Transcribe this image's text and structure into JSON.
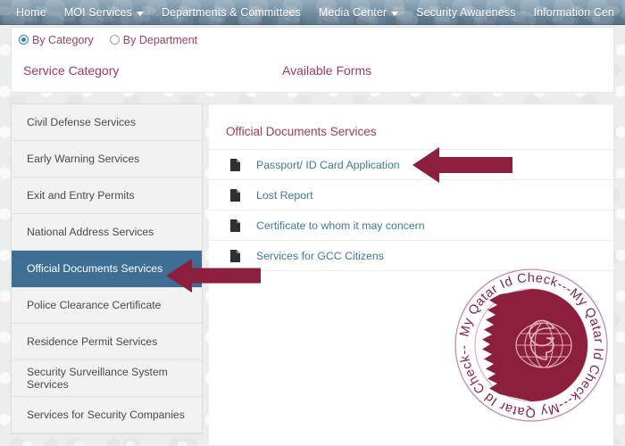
{
  "colors": {
    "navbar_bg": "#6e8ca3",
    "accent_maroon": "#a23a52",
    "link_blue": "#3b7a99",
    "selected_row_bg": "#3f6e94",
    "arrow_maroon": "#8c1f3d",
    "seal_maroon": "#8c1f3d",
    "radio_blue": "#2b7fd4"
  },
  "navbar": {
    "items": [
      {
        "label": "Home",
        "has_caret": false
      },
      {
        "label": "MOI Services",
        "has_caret": true
      },
      {
        "label": "Departments & Committees",
        "has_caret": false
      },
      {
        "label": "Media Center",
        "has_caret": true
      },
      {
        "label": "Security Awareness",
        "has_caret": false
      },
      {
        "label": "Information Cen",
        "has_caret": false
      }
    ]
  },
  "filter": {
    "options": [
      {
        "label": "By Category",
        "selected": true
      },
      {
        "label": "By Department",
        "selected": false
      }
    ]
  },
  "headers": {
    "service_category": "Service Category",
    "available_forms": "Available Forms"
  },
  "sidebar": {
    "items": [
      {
        "label": "Civil Defense Services",
        "active": false
      },
      {
        "label": "Early Warning Services",
        "active": false
      },
      {
        "label": "Exit and Entry Permits",
        "active": false
      },
      {
        "label": "National Address Services",
        "active": false
      },
      {
        "label": "Official Documents Services",
        "active": true
      },
      {
        "label": "Police Clearance Certificate",
        "active": false
      },
      {
        "label": "Residence Permit Services",
        "active": false
      },
      {
        "label": "Security Surveillance System Services",
        "active": false
      },
      {
        "label": "Services for Security Companies",
        "active": false
      }
    ]
  },
  "content": {
    "title": "Official Documents Services",
    "forms": [
      {
        "label": "Passport/ ID Card Application",
        "icon": "document-icon"
      },
      {
        "label": "Lost Report",
        "icon": "document-icon"
      },
      {
        "label": "Certificate to whom it may concern",
        "icon": "document-icon"
      },
      {
        "label": "Services for GCC Citizens",
        "icon": "document-icon"
      }
    ]
  },
  "seal": {
    "ring_text": "My Qatar Id Check---My Qatar Id Check---My Qatar Id Check---",
    "emblem": "globe-g-emblem"
  },
  "annotations": [
    {
      "name": "arrow-pointing-to-passport-id-card-application",
      "direction": "left"
    },
    {
      "name": "arrow-pointing-to-official-documents-services",
      "direction": "left"
    }
  ]
}
